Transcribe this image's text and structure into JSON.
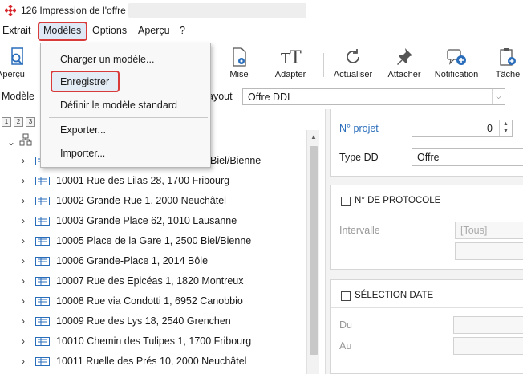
{
  "window": {
    "title": "126 Impression de l'offre"
  },
  "menubar": {
    "items": [
      {
        "label": "Extrait"
      },
      {
        "label": "Modèles"
      },
      {
        "label": "Options"
      },
      {
        "label": "Aperçu"
      },
      {
        "label": "?"
      }
    ]
  },
  "toolbar": {
    "apercu_label": "Aperçu",
    "items": [
      {
        "label": "Mise",
        "icon": "page-gear-icon"
      },
      {
        "label": "Adapter",
        "icon": "text-size-icon"
      },
      {
        "label": "Actualiser",
        "icon": "refresh-icon"
      },
      {
        "label": "Attacher",
        "icon": "pin-icon"
      },
      {
        "label": "Notification",
        "icon": "chat-add-icon"
      },
      {
        "label": "Tâche",
        "icon": "clipboard-icon"
      }
    ]
  },
  "modele_row": {
    "modele_label": "Modèle",
    "layout_label": "ayout",
    "layout_value": "Offre DDL"
  },
  "dropdown": {
    "items": [
      {
        "label": "Charger un modèle..."
      },
      {
        "label": "Enregistrer"
      },
      {
        "label": "Définir le modèle standard"
      },
      {
        "label": "Exporter..."
      },
      {
        "label": "Importer..."
      }
    ]
  },
  "tree": {
    "levels": [
      "1",
      "2",
      "3"
    ],
    "rows": [
      {
        "text": "Biel/Bienne"
      },
      {
        "text": "10001 Rue des Lilas 28, 1700 Fribourg"
      },
      {
        "text": "10002 Grande-Rue 1, 2000 Neuchâtel"
      },
      {
        "text": "10003 Grande Place 62, 1010 Lausanne"
      },
      {
        "text": "10005 Place de la Gare 1, 2500 Biel/Bienne"
      },
      {
        "text": "10006 Grande-Place 1, 2014 Bôle"
      },
      {
        "text": "10007 Rue des Epicéas 1, 1820 Montreux"
      },
      {
        "text": "10008 Rue via Condotti 1, 6952 Canobbio"
      },
      {
        "text": "10009 Rue des Lys 18, 2540 Grenchen"
      },
      {
        "text": "10010 Chemin des Tulipes 1, 1700 Fribourg"
      },
      {
        "text": "10011 Ruelle des Prés 10, 2000 Neuchâtel"
      }
    ]
  },
  "right": {
    "no_projet_label": "N° projet",
    "no_projet_value": "0",
    "type_dd_label": "Type DD",
    "type_dd_value": "Offre",
    "protocole_title": "N° DE PROTOCOLE",
    "intervalle_label": "Intervalle",
    "intervalle_value": "[Tous]",
    "date_title": "SÉLECTION DATE",
    "du_label": "Du",
    "au_label": "Au",
    "accent_color": "#2a6ebb"
  }
}
